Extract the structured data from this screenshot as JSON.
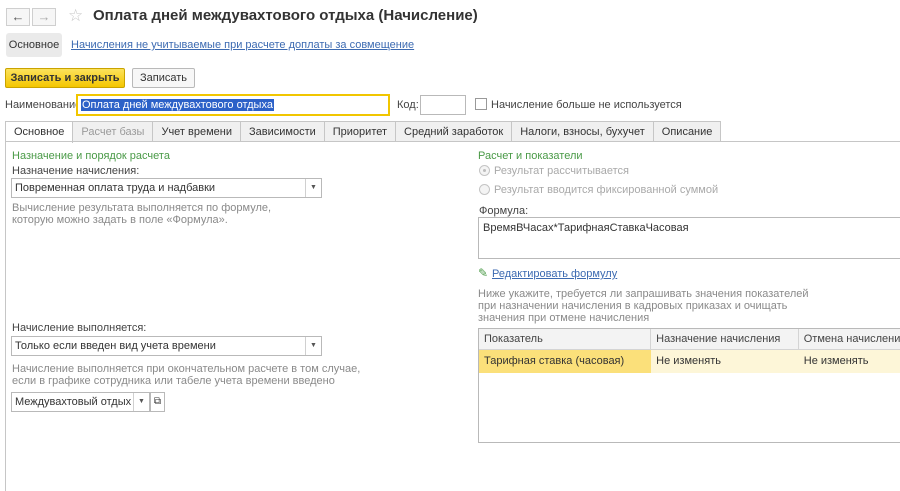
{
  "window": {
    "title": "Оплата дней междувахтового отдыха (Начисление)"
  },
  "nav": {
    "back_icon": "←",
    "forward_icon": "→",
    "favorite_icon": "☆"
  },
  "sections": {
    "main": "Основное",
    "link": "Начисления не учитываемые при расчете доплаты за совмещение"
  },
  "commands": {
    "save_close": "Записать и закрыть",
    "save": "Записать"
  },
  "header": {
    "name_label": "Наименование:",
    "name_value": "Оплата дней междувахтового отдыха",
    "code_label": "Код:",
    "code_value": "",
    "not_used_label": "Начисление больше не используется"
  },
  "tabs": [
    {
      "label": "Основное"
    },
    {
      "label": "Расчет базы"
    },
    {
      "label": "Учет времени"
    },
    {
      "label": "Зависимости"
    },
    {
      "label": "Приоритет"
    },
    {
      "label": "Средний заработок"
    },
    {
      "label": "Налоги, взносы, бухучет"
    },
    {
      "label": "Описание"
    }
  ],
  "left": {
    "group_title": "Назначение и порядок расчета",
    "purpose_label": "Назначение начисления:",
    "purpose_value": "Повременная оплата труда и надбавки",
    "purpose_hint_1": "Вычисление результата выполняется по формуле,",
    "purpose_hint_2": "которую можно задать в поле «Формула».",
    "exec_label": "Начисление выполняется:",
    "exec_value": "Только если введен вид учета времени",
    "exec_hint_1": "Начисление выполняется при окончательном расчете в том случае,",
    "exec_hint_2": "если в графике сотрудника или табеле учета времени введено",
    "time_type_value": "Междувахтовый отдых"
  },
  "right": {
    "group_title": "Расчет и показатели",
    "radio_calc": "Результат рассчитывается",
    "radio_fixed": "Результат вводится фиксированной суммой",
    "formula_label": "Формула:",
    "formula_value": "ВремяВЧасах*ТарифнаяСтавкаЧасовая",
    "edit_formula": "Редактировать формулу",
    "indicators_hint_1": "Ниже укажите, требуется ли запрашивать значения показателей",
    "indicators_hint_2": "при назначении начисления в кадровых приказах и очищать",
    "indicators_hint_3": "значения при отмене начисления",
    "table": {
      "columns": [
        "Показатель",
        "Назначение начисления",
        "Отмена начисления"
      ],
      "rows": [
        [
          "Тарифная ставка (часовая)",
          "Не изменять",
          "Не изменять"
        ]
      ]
    }
  }
}
